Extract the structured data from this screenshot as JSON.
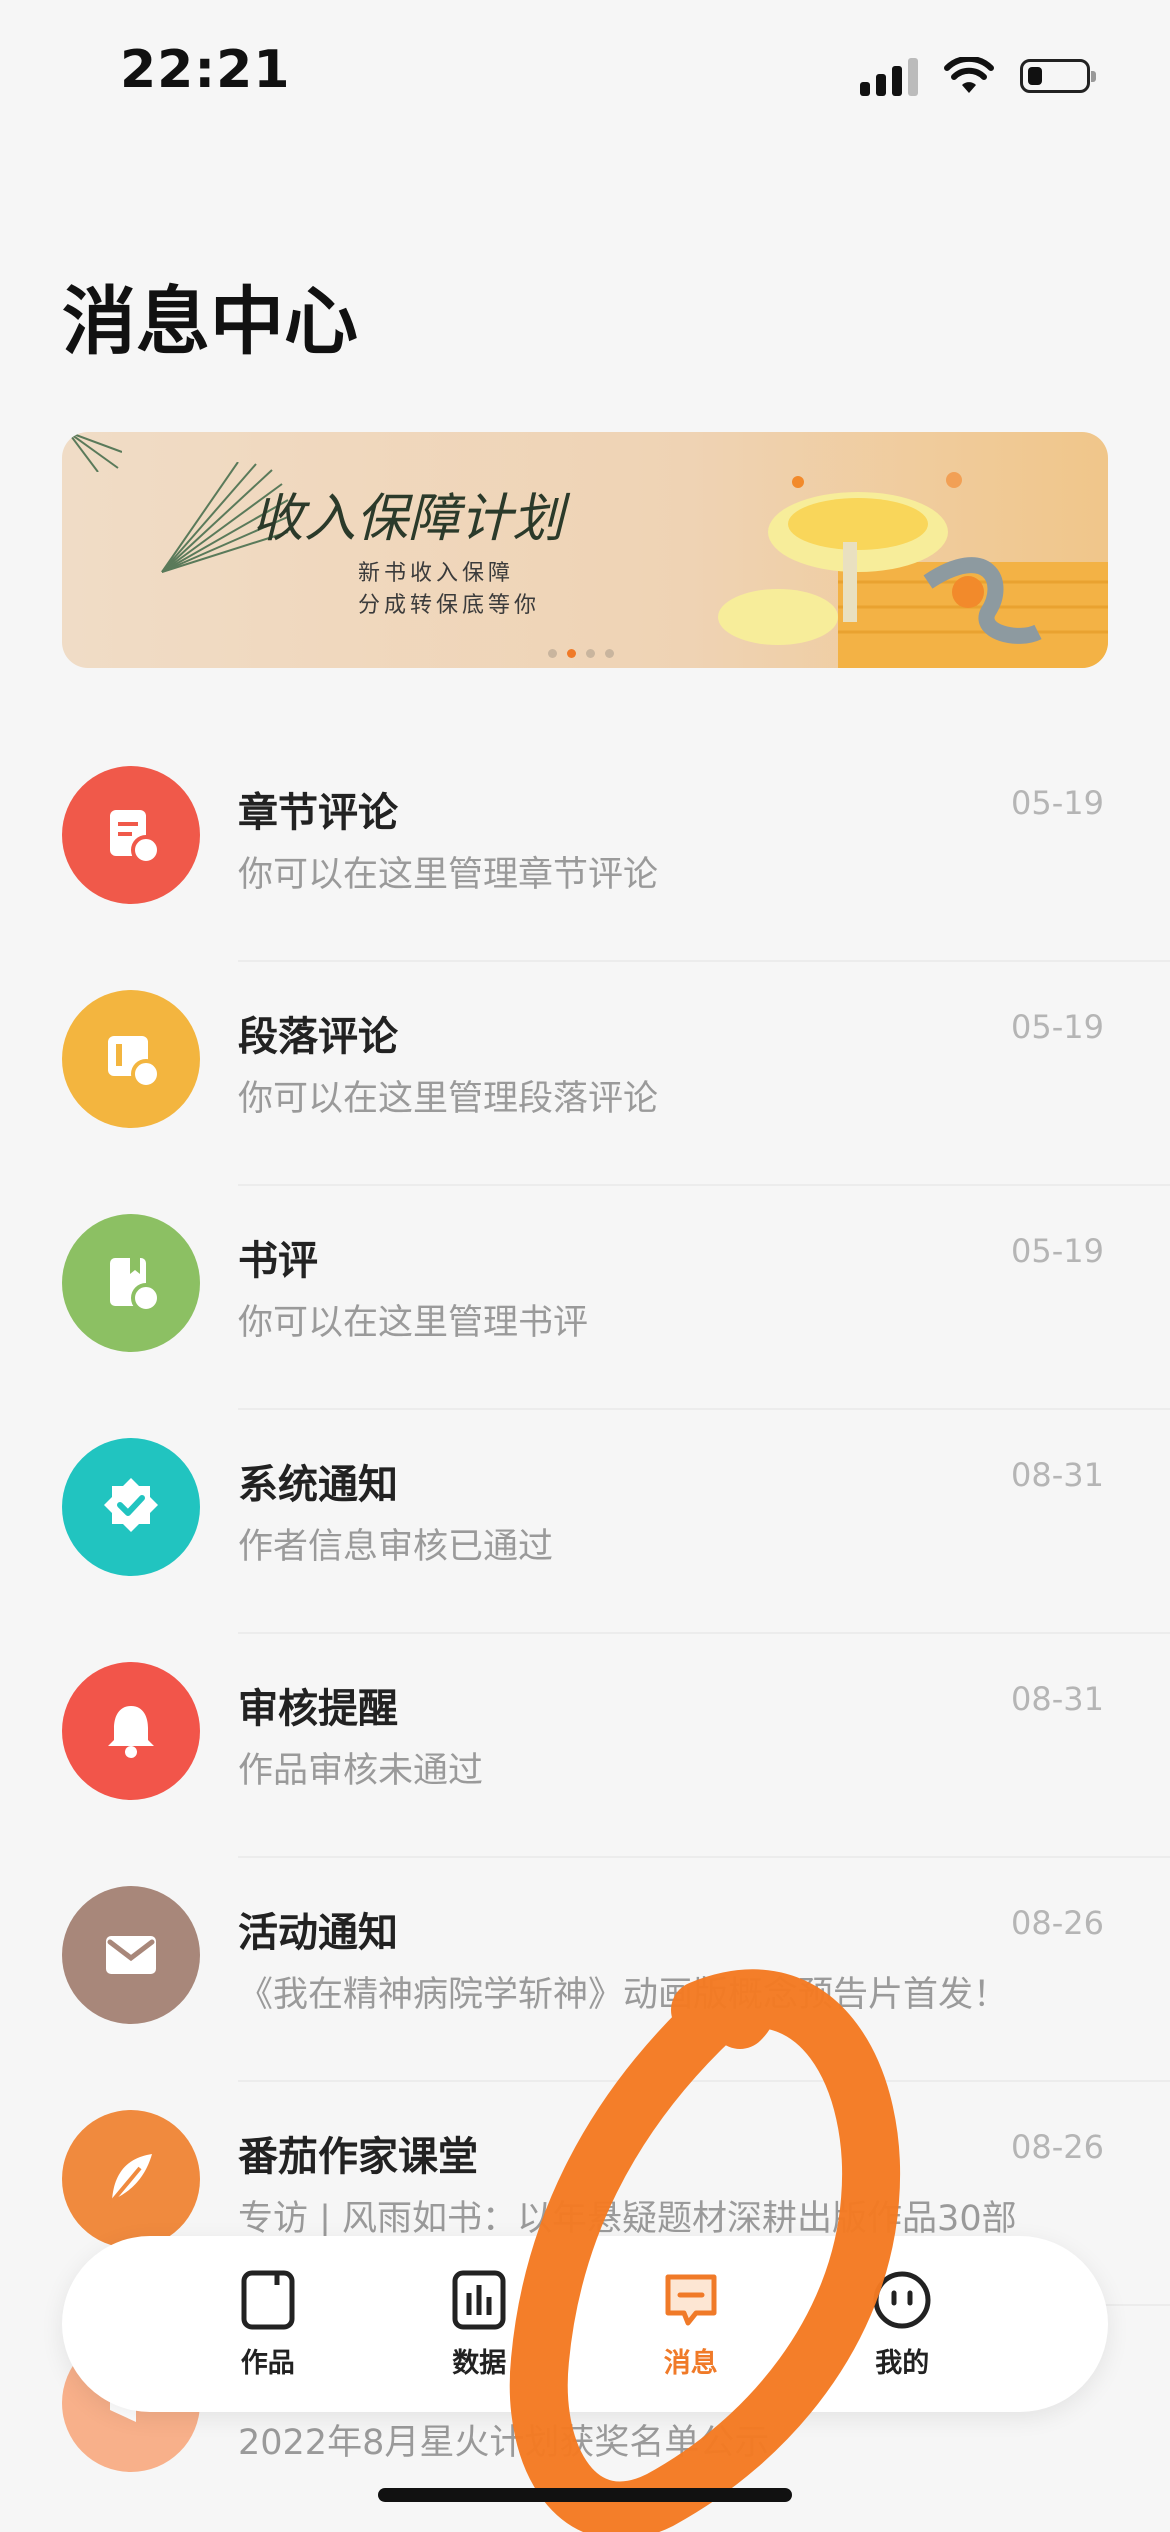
{
  "status_bar": {
    "time": "22:21"
  },
  "page": {
    "title": "消息中心"
  },
  "banner": {
    "title": "收入保障计划",
    "sub_line1": "新书收入保障",
    "sub_line2": "分成转保底等你"
  },
  "messages": [
    {
      "title": "章节评论",
      "subtitle": "你可以在这里管理章节评论",
      "date": "05-19",
      "icon": "chapter-comment-icon",
      "color": "#f0594a"
    },
    {
      "title": "段落评论",
      "subtitle": "你可以在这里管理段落评论",
      "date": "05-19",
      "icon": "paragraph-comment-icon",
      "color": "#f3b53f"
    },
    {
      "title": "书评",
      "subtitle": "你可以在这里管理书评",
      "date": "05-19",
      "icon": "book-review-icon",
      "color": "#8cc063"
    },
    {
      "title": "系统通知",
      "subtitle": "作者信息审核已通过",
      "date": "08-31",
      "icon": "system-badge-icon",
      "color": "#21c4c0"
    },
    {
      "title": "审核提醒",
      "subtitle": "作品审核未通过",
      "date": "08-31",
      "icon": "bell-icon",
      "color": "#f2554a"
    },
    {
      "title": "活动通知",
      "subtitle": "《我在精神病院学斩神》动画版概念预告片首发！",
      "date": "08-26",
      "icon": "mail-icon",
      "color": "#a8877a"
    },
    {
      "title": "番茄作家课堂",
      "subtitle": "专访 | 风雨如书：以年悬疑题材深耕出版作品30部",
      "date": "08-26",
      "icon": "feather-icon",
      "color": "#f08a3e"
    },
    {
      "title": "",
      "subtitle": "2022年8月星火计划获奖名单公示",
      "date": "",
      "icon": "megaphone-icon",
      "color": "#f8b08a"
    }
  ],
  "nav": {
    "items": [
      {
        "label": "作品",
        "icon": "works-icon",
        "active": false
      },
      {
        "label": "数据",
        "icon": "chart-icon",
        "active": false
      },
      {
        "label": "消息",
        "icon": "message-icon",
        "active": true
      },
      {
        "label": "我的",
        "icon": "profile-icon",
        "active": false
      }
    ],
    "active_color": "#f07a28"
  },
  "colors": {
    "accent": "#f07a28",
    "background": "#f6f6f6"
  }
}
